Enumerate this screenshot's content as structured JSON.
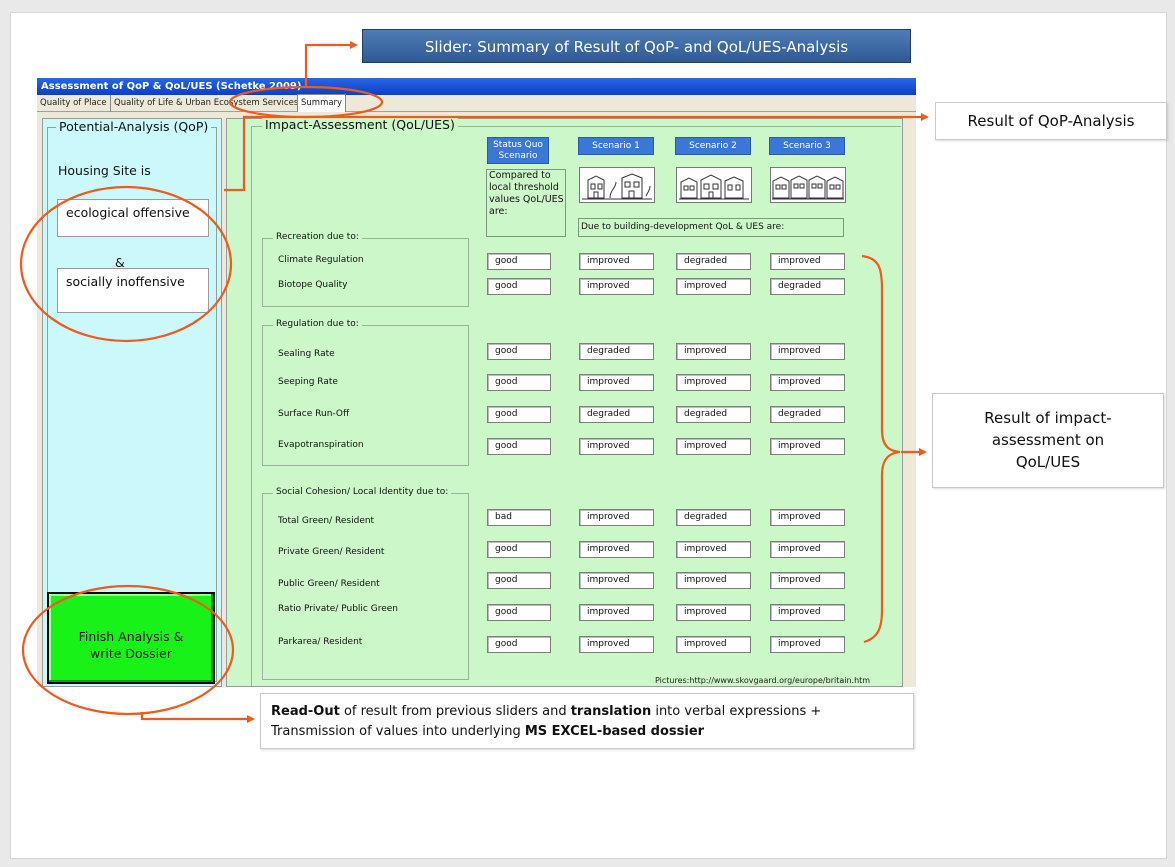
{
  "callouts": {
    "slider_summary": "Slider: Summary of Result of QoP- and QoL/UES-Analysis",
    "qop_result": "Result of QoP-Analysis",
    "impact_result_lines": [
      "Result of impact-",
      "assessment on",
      "QoL/UES"
    ],
    "readout": {
      "bold1": "Read-Out",
      "t1": " of result from previous sliders and ",
      "bold2": "translation",
      "t2": " into verbal expressions +",
      "t3": "Transmission of values into underlying ",
      "bold3": "MS EXCEL-based dossier"
    }
  },
  "window": {
    "title": "Assessment of QoP & QoL/UES (Schetke 2009)",
    "tabs": [
      "Quality of Place",
      "Quality of Life & Urban Ecosystem Services",
      "Summary"
    ],
    "active_tab": "Summary"
  },
  "qop": {
    "legend": "Potential-Analysis (QoP)",
    "housing_label": "Housing Site is",
    "result1": "ecological offensive",
    "amp": "&",
    "result2": "socially inoffensive",
    "finish_line1": "Finish Analysis &",
    "finish_line2": "write Dossier"
  },
  "impact": {
    "legend": "Impact-Assessment (QoL/UES)",
    "status_quo_header": [
      "Status Quo",
      "Scenario"
    ],
    "scenario_headers": [
      "Scenario 1",
      "Scenario 2",
      "Scenario 3"
    ],
    "compared_text": [
      "Compared to",
      "local threshold",
      "values QoL/UES",
      "are:"
    ],
    "due_text": "Due to building-development QoL & UES are:",
    "pictures_credit": "Pictures:http://www.skovgaard.org/europe/britain.htm",
    "groups": [
      {
        "label": "Recreation due to:",
        "rows": [
          {
            "label": "Climate Regulation",
            "values": [
              "good",
              "improved",
              "degraded",
              "improved"
            ]
          },
          {
            "label": "Biotope Quality",
            "values": [
              "good",
              "improved",
              "improved",
              "degraded"
            ]
          }
        ]
      },
      {
        "label": "Regulation due to:",
        "rows": [
          {
            "label": "Sealing Rate",
            "values": [
              "good",
              "degraded",
              "improved",
              "improved"
            ]
          },
          {
            "label": "Seeping Rate",
            "values": [
              "good",
              "improved",
              "improved",
              "improved"
            ]
          },
          {
            "label": "Surface Run-Off",
            "values": [
              "good",
              "degraded",
              "degraded",
              "degraded"
            ]
          },
          {
            "label": "Evapotranspiration",
            "values": [
              "good",
              "improved",
              "improved",
              "improved"
            ]
          }
        ]
      },
      {
        "label": "Social Cohesion/ Local Identity due to:",
        "rows": [
          {
            "label": "Total Green/ Resident",
            "values": [
              "bad",
              "improved",
              "degraded",
              "improved"
            ]
          },
          {
            "label": "Private Green/ Resident",
            "values": [
              "good",
              "improved",
              "improved",
              "improved"
            ]
          },
          {
            "label": "Public Green/ Resident",
            "values": [
              "good",
              "improved",
              "improved",
              "improved"
            ]
          },
          {
            "label": "Ratio Private/ Public Green",
            "values": [
              "good",
              "improved",
              "improved",
              "improved"
            ]
          },
          {
            "label": "Parkarea/ Resident",
            "values": [
              "good",
              "improved",
              "improved",
              "improved"
            ]
          }
        ]
      }
    ]
  },
  "colors": {
    "annotation": "#f05a1e",
    "title_blue": "#0a3fc6",
    "header_blue": "#3b77d6",
    "qop_bg": "#cbf9fb",
    "impact_bg": "#ccf7c9",
    "finish_green": "#19f219"
  }
}
